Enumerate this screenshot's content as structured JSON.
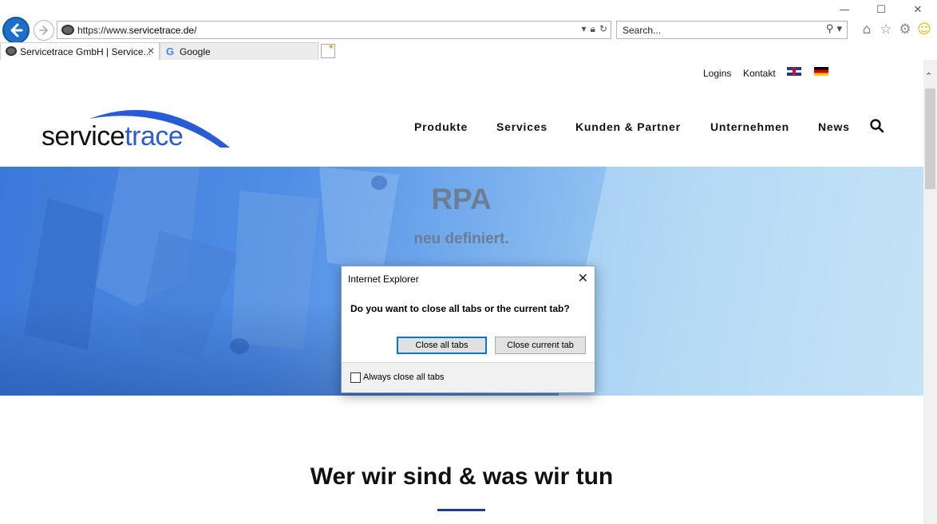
{
  "window": {
    "minimize": "—",
    "maximize": "☐",
    "close": "✕"
  },
  "address_bar": {
    "url_prefix": "https://www.",
    "url_host": "servicetrace.de",
    "url_suffix": "/",
    "icons": [
      "dropdown-icon",
      "lock-icon",
      "refresh-icon"
    ]
  },
  "search_box": {
    "placeholder": "Search...",
    "icons": [
      "search-icon",
      "dropdown-icon"
    ]
  },
  "toolbar_icons": [
    "home-icon",
    "favorites-star-icon",
    "settings-gear-icon",
    "feedback-smiley-icon"
  ],
  "tabs": [
    {
      "label": "Servicetrace GmbH | Service...",
      "active": true
    },
    {
      "label": "Google",
      "active": false
    }
  ],
  "topbar": {
    "logins": "Logins",
    "kontakt": "Kontakt"
  },
  "logo": {
    "part1": "service",
    "part2": "trace"
  },
  "nav": [
    "Produkte",
    "Services",
    "Kunden & Partner",
    "Unternehmen",
    "News"
  ],
  "hero": {
    "title": "RPA",
    "subtitle": "neu definiert."
  },
  "section": {
    "title": "Wer wir sind & was wir tun"
  },
  "dialog": {
    "title": "Internet Explorer",
    "message": "Do you want to close all tabs or the current tab?",
    "close_all_label": "Close all tabs",
    "close_current_label": "Close current tab",
    "checkbox_label": "Always close all tabs",
    "checkbox_checked": false
  },
  "colors": {
    "brand_blue": "#2a5bd7",
    "accent_rule": "#1d3b8f",
    "ie_blue": "#1e6fc7"
  }
}
